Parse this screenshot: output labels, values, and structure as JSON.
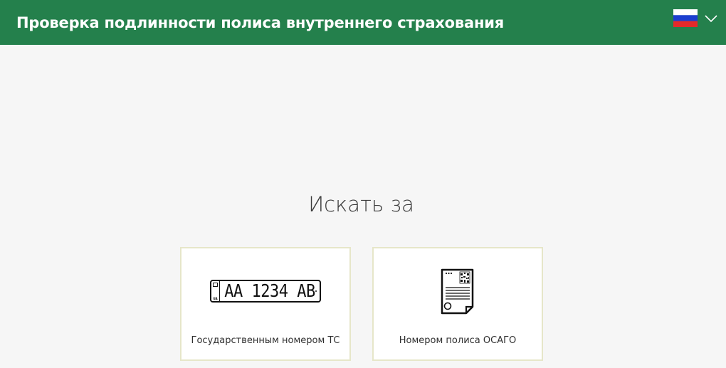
{
  "header": {
    "title": "Проверка подлинности полиса внутреннего страхования",
    "language_flag": "russia-flag-icon",
    "language_menu_icon": "chevron-down-icon"
  },
  "main": {
    "heading": "Искать за",
    "options": [
      {
        "label": "Государственным номером ТС",
        "icon": "license-plate-icon",
        "plate_text": "AA 1234 AB"
      },
      {
        "label": "Номером полиса ОСАГО",
        "icon": "insurance-policy-document-icon"
      }
    ]
  },
  "colors": {
    "brand": "#24804c",
    "background": "#f6f6f6",
    "card_border": "#e6e6c9"
  }
}
